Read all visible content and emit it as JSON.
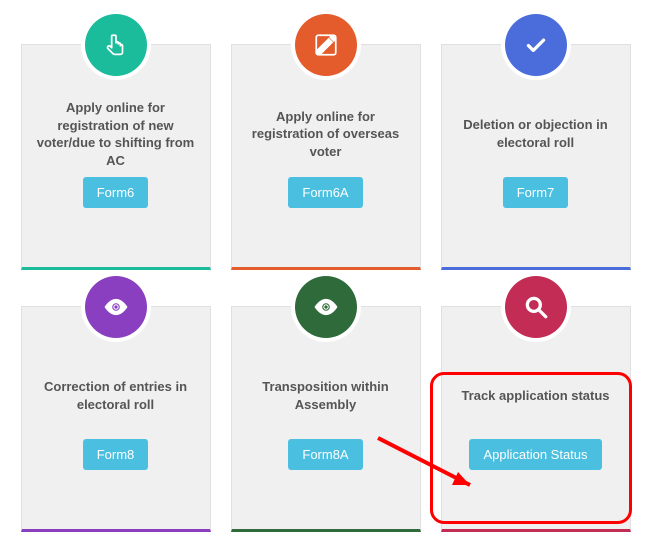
{
  "cards": [
    {
      "title": "Apply online for registration of new voter/due to shifting from AC",
      "button": "Form6",
      "icon": "pointer",
      "accent": "teal"
    },
    {
      "title": "Apply online for registration of overseas voter",
      "button": "Form6A",
      "icon": "edit",
      "accent": "orange"
    },
    {
      "title": "Deletion or objection in electoral roll",
      "button": "Form7",
      "icon": "check",
      "accent": "blue"
    },
    {
      "title": "Correction of entries in electoral roll",
      "button": "Form8",
      "icon": "eye",
      "accent": "purple"
    },
    {
      "title": "Transposition within Assembly",
      "button": "Form8A",
      "icon": "eye",
      "accent": "green"
    },
    {
      "title": "Track application status",
      "button": "Application Status",
      "icon": "search",
      "accent": "crimson"
    }
  ],
  "annotation": {
    "highlight_card_index": 5
  }
}
